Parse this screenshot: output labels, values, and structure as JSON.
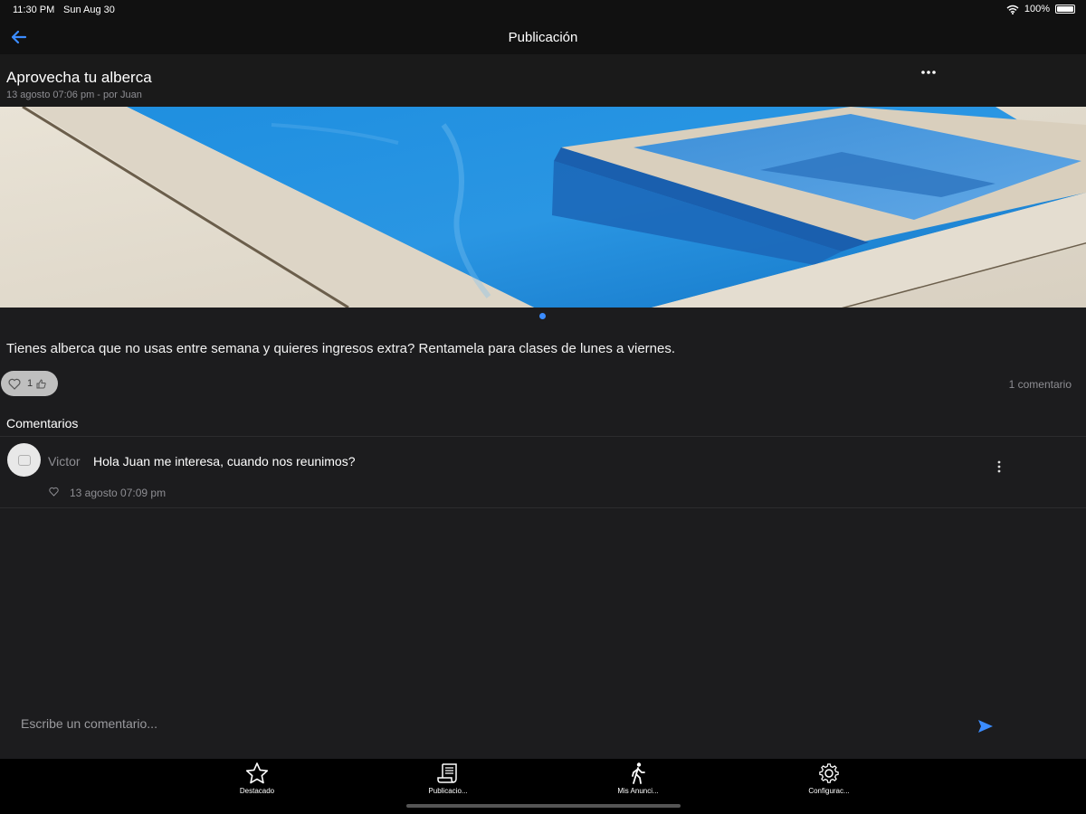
{
  "status_bar": {
    "time": "11:30 PM",
    "date": "Sun Aug 30",
    "battery": "100%",
    "battery_level": 1.0
  },
  "nav": {
    "title": "Publicación",
    "back_icon": "arrow-left-icon"
  },
  "post": {
    "title": "Aprovecha tu alberca",
    "meta": "13 agosto 07:06 pm - por Juan",
    "body": "Tienes alberca que no usas entre semana y quieres ingresos extra? Rentamela para clases de lunes a viernes.",
    "like_count": "1",
    "comment_count": "1 comentario"
  },
  "comments_section": {
    "label": "Comentarios",
    "items": [
      {
        "author": "Victor",
        "text": "Hola Juan me interesa, cuando nos reunimos?",
        "time": "13 agosto 07:09 pm"
      }
    ]
  },
  "composer": {
    "placeholder": "Escribe un comentario..."
  },
  "tabs": [
    {
      "label": "Destacado",
      "icon": "star-icon"
    },
    {
      "label": "Publicacio...",
      "icon": "scroll-icon"
    },
    {
      "label": "Mis Anunci...",
      "icon": "walking-person-icon"
    },
    {
      "label": "Configurac...",
      "icon": "gear-icon"
    }
  ],
  "colors": {
    "accent": "#3b8cff",
    "background": "#1c1c1e",
    "tab_bar": "#000000"
  }
}
